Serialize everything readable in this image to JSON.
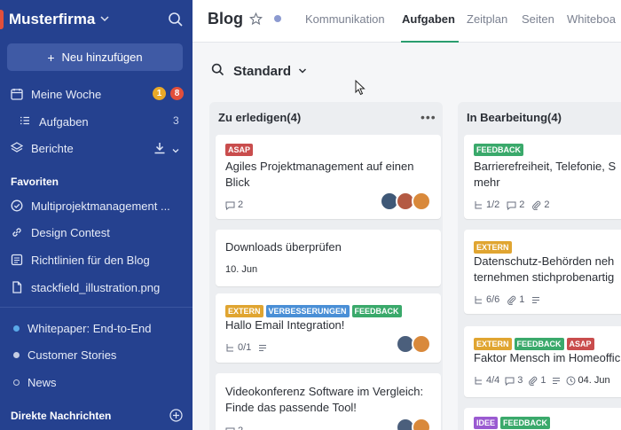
{
  "workspace": {
    "name": "Musterfirma"
  },
  "sidebar": {
    "new_button": "Neu hinzufügen",
    "items": [
      {
        "label": "Meine Woche",
        "badge_yellow": "1",
        "badge_red": "8"
      },
      {
        "label": "Aufgaben",
        "count": "3"
      },
      {
        "label": "Berichte"
      }
    ],
    "favorites_heading": "Favoriten",
    "favorites": [
      {
        "label": "Multiprojektmanagement ..."
      },
      {
        "label": "Design Contest"
      },
      {
        "label": "Richtlinien für den Blog"
      },
      {
        "label": "stackfield_illustration.png"
      }
    ],
    "rooms": [
      {
        "label": "Whitepaper: End-to-End"
      },
      {
        "label": "Customer Stories"
      },
      {
        "label": "News"
      }
    ],
    "dm_heading": "Direkte Nachrichten"
  },
  "header": {
    "title": "Blog",
    "tabs": [
      "Kommunikation",
      "Aufgaben",
      "Zeitplan",
      "Seiten",
      "Whiteboa"
    ],
    "active_tab": "Aufgaben"
  },
  "filter": {
    "label": "Standard"
  },
  "columns": [
    {
      "title": "Zu erledigen(4)",
      "cards": [
        {
          "tags": [
            {
              "text": "ASAP",
              "color": "#c94d4d"
            }
          ],
          "title": "Agiles Projektmanagement auf einen Blick",
          "comments": "2"
        },
        {
          "title": "Downloads überprüfen",
          "date": "10. Jun"
        },
        {
          "tags": [
            {
              "text": "EXTERN",
              "color": "#e0a531"
            },
            {
              "text": "VERBESSERUNGEN",
              "color": "#4a8fd6"
            },
            {
              "text": "FEEDBACK",
              "color": "#3aa96b"
            }
          ],
          "title": "Hallo Email Integration!",
          "subtasks": "0/1"
        },
        {
          "title": "Videokonferenz Software im Vergleich: Finde das passende Tool!",
          "comments": "2"
        }
      ]
    },
    {
      "title": "In Bearbeitung(4)",
      "cards": [
        {
          "tags": [
            {
              "text": "FEEDBACK",
              "color": "#3aa96b"
            }
          ],
          "title": "Barrierefreiheit, Telefonie, S mehr",
          "subtasks": "1/2",
          "comments": "2",
          "attachments": "2"
        },
        {
          "tags": [
            {
              "text": "EXTERN",
              "color": "#e0a531"
            }
          ],
          "title": "Datenschutz-Behörden neh ternehmen stichprobenartig",
          "subtasks": "6/6",
          "attachments": "1"
        },
        {
          "tags": [
            {
              "text": "EXTERN",
              "color": "#e0a531"
            },
            {
              "text": "FEEDBACK",
              "color": "#3aa96b"
            },
            {
              "text": "ASAP",
              "color": "#c94d4d"
            }
          ],
          "title": "Faktor Mensch im Homeoffic",
          "subtasks": "4/4",
          "comments": "3",
          "attachments": "1",
          "date": "04. Jun"
        },
        {
          "tags": [
            {
              "text": "IDEE",
              "color": "#9a5ad1"
            },
            {
              "text": "FEEDBACK",
              "color": "#3aa96b"
            }
          ]
        }
      ]
    }
  ],
  "colors": {
    "sidebar": "#25418f",
    "accent": "#2a9d6f",
    "badge_red": "#e24f3b",
    "badge_yellow": "#e9a928"
  }
}
